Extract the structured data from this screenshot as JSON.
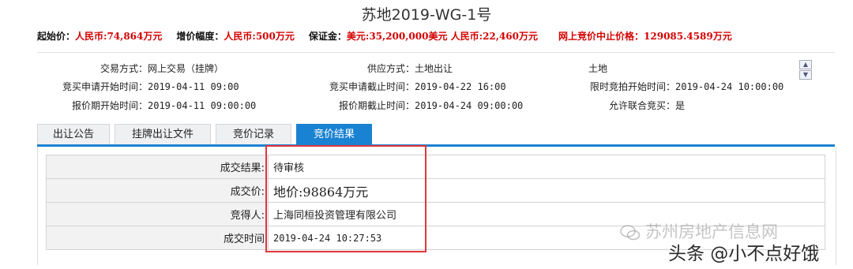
{
  "title": "苏地2019-WG-1号",
  "price_bar": {
    "start_price_label": "起始价：",
    "start_price_value": "人民币:74,864万元",
    "increment_label": "增价幅度：",
    "increment_value": "人民币:500万元",
    "deposit_label": "保证金：",
    "deposit_value": "美元:35,200,000美元 人民币:22,460万元",
    "stop_price_label": "网上竞价中止价格：",
    "stop_price_value": "129085.4589万元"
  },
  "info": {
    "trade_mode_label": "交易方式：",
    "trade_mode_value": "网上交易（挂牌）",
    "supply_mode_label": "供应方式：",
    "supply_mode_value": "土地出让",
    "land_type": "土地",
    "apply_start_label": "竞买申请开始时间：",
    "apply_start_value": "2019-04-11 09:00",
    "apply_end_label": "竞买申请截止时间：",
    "apply_end_value": "2019-04-22 16:00",
    "bid_start_label": "限时竞拍开始时间：",
    "bid_start_value": "2019-04-24 10:00:00",
    "quote_start_label": "报价期开始时间：",
    "quote_start_value": "2019-04-11 09:00:00",
    "quote_end_label": "报价期截止时间：",
    "quote_end_value": "2019-04-24 09:00:00",
    "joint_bid_label": "允许联合竞买：",
    "joint_bid_value": "是"
  },
  "tabs": [
    "出让公告",
    "挂牌出让文件",
    "竞价记录",
    "竞价结果"
  ],
  "active_tab": 3,
  "result": {
    "rows": [
      {
        "label": "成交结果:",
        "value": "待审核"
      },
      {
        "label": "成交价:",
        "value": "地价:98864万元"
      },
      {
        "label": "竞得人:",
        "value": "上海同桓投资管理有限公司"
      },
      {
        "label": "成交时间",
        "value": "2019-04-24 10:27:53"
      }
    ]
  },
  "watermark": {
    "source": "苏州房地产信息网",
    "author": "头条 @小不点好饿"
  },
  "colors": {
    "accent": "#1a82d2",
    "price_red": "#d40000",
    "highlight_box": "#e0383c"
  }
}
